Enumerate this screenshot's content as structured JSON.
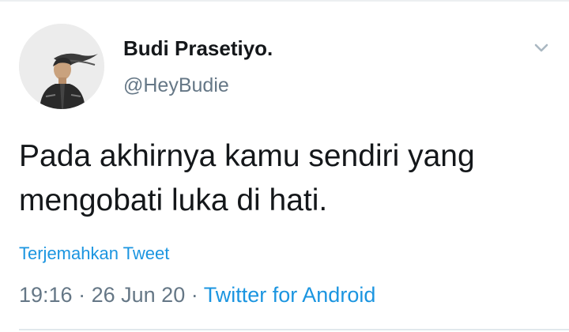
{
  "tweet": {
    "author": {
      "display_name": "Budi Prasetiyo.",
      "handle": "@HeyBudie",
      "avatar_icon": "profile-photo"
    },
    "text": "Pada akhirnya kamu sendiri yang mengobati luka di hati.",
    "translate_label": "Terjemahkan Tweet",
    "time": "19:16",
    "separator": "·",
    "date": "26 Jun 20",
    "source": "Twitter for Android",
    "more_icon": "chevron-down-icon"
  },
  "colors": {
    "text": "#14171a",
    "secondary": "#657786",
    "link": "#1b95e0",
    "divider": "#e1e8ed"
  }
}
